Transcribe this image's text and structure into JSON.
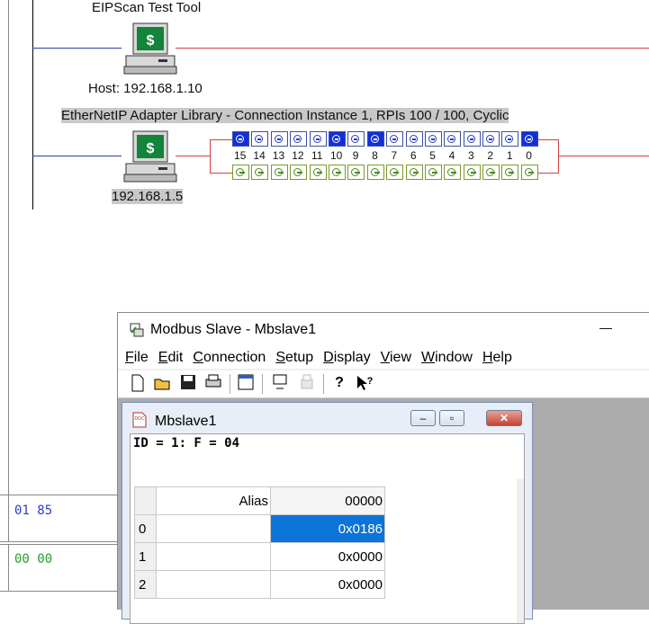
{
  "eip": {
    "test_tool_title": "EIPScan Test Tool",
    "host_label": "Host: 192.168.1.10",
    "adapter_caption": "EtherNetIP Adapter Library - Connection Instance 1, RPIs 100 / 100, Cyclic",
    "adapter_ip": "192.168.1.5",
    "bit_numbers": [
      "15",
      "14",
      "13",
      "12",
      "11",
      "10",
      "9",
      "8",
      "7",
      "6",
      "5",
      "4",
      "3",
      "2",
      "1",
      "0"
    ],
    "hex_in": "01 85",
    "hex_out": "00 00",
    "colors": {
      "host_line": "#d24040",
      "device_line": "#2c3fa4",
      "bit_on": "#1330d8"
    }
  },
  "modbus_window": {
    "title": "Modbus Slave - Mbslave1",
    "minimize_glyph": "—",
    "menus": [
      {
        "label": "File",
        "ul": "F",
        "rest": "ile"
      },
      {
        "label": "Edit",
        "ul": "E",
        "rest": "dit"
      },
      {
        "label": "Connection",
        "ul": "C",
        "rest": "onnection"
      },
      {
        "label": "Setup",
        "ul": "S",
        "rest": "etup"
      },
      {
        "label": "Display",
        "ul": "D",
        "rest": "isplay"
      },
      {
        "label": "View",
        "ul": "V",
        "rest": "iew"
      },
      {
        "label": "Window",
        "ul": "W",
        "rest": "indow"
      },
      {
        "label": "Help",
        "ul": "H",
        "rest": "elp"
      }
    ],
    "toolbar_icons": [
      "new-icon",
      "open-icon",
      "save-icon",
      "print-icon",
      "window-icon",
      "monitor-icon",
      "printer-disabled-icon",
      "help-icon",
      "context-help-icon"
    ]
  },
  "child_window": {
    "title": "Mbslave1",
    "id_line": "ID = 1: F = 04",
    "col_alias": "Alias",
    "col_addr": "00000",
    "rows": [
      {
        "idx": "0",
        "alias": "",
        "value": "0x0186"
      },
      {
        "idx": "1",
        "alias": "",
        "value": "0x0000"
      },
      {
        "idx": "2",
        "alias": "",
        "value": "0x0000"
      }
    ]
  }
}
